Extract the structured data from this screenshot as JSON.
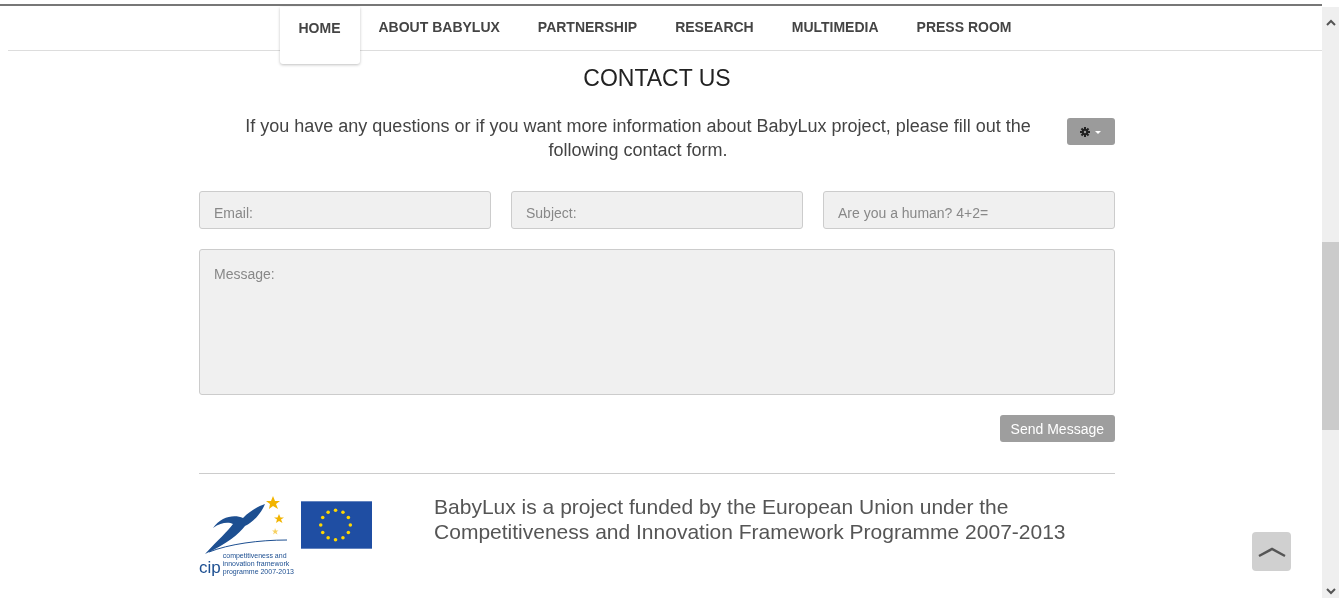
{
  "nav": {
    "items": [
      {
        "label": "HOME",
        "selected": true
      },
      {
        "label": "ABOUT BABYLUX",
        "selected": false
      },
      {
        "label": "PARTNERSHIP",
        "selected": false
      },
      {
        "label": "RESEARCH",
        "selected": false
      },
      {
        "label": "MULTIMEDIA",
        "selected": false
      },
      {
        "label": "PRESS ROOM",
        "selected": false
      }
    ]
  },
  "contact": {
    "title": "CONTACT US",
    "intro": "If you have any questions or if you want more information about BabyLux project, please fill out the following contact form.",
    "fields": [
      {
        "placeholder": "Email:"
      },
      {
        "placeholder": "Subject:"
      },
      {
        "placeholder": "Are you a human? 4+2="
      }
    ],
    "message": {
      "placeholder": "Message:"
    },
    "send_button": "Send Message"
  },
  "footer": {
    "cip_logo": {
      "wordmark": "cip",
      "tagline": "competitiveness and innovation framework programme 2007-2013"
    },
    "funding_text": "BabyLux is a project funded by the European Union under the Competitiveness and Innovation Framework Programme 2007-2013"
  }
}
